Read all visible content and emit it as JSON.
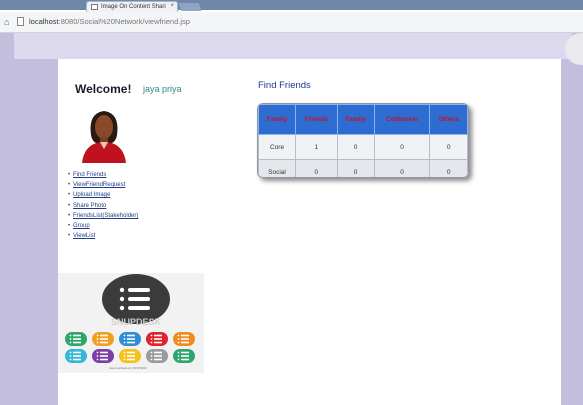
{
  "browser": {
    "tab_title": "Image On Content Shari",
    "tab_close": "×",
    "home_glyph": "⌂",
    "url_host": "localhost",
    "url_path": ":8080/Social%20Network/viewfriend.jsp"
  },
  "header": {
    "welcome": "Welcome!",
    "username": "jaya priya"
  },
  "sidebar": {
    "bullet": "•",
    "links": [
      {
        "label": "Find Friends"
      },
      {
        "label": "ViewFriendRequest"
      },
      {
        "label": "Upload Image"
      },
      {
        "label": "Share Photo"
      },
      {
        "label": "FriendsList(Stakeholder)"
      },
      {
        "label": "Group"
      },
      {
        "label": "ViewList"
      }
    ]
  },
  "logo": {
    "faded_text": "SNUPDESK",
    "small_text": "www.snupdesk.com     SNUPDESK",
    "dark_color": "#3b3b3b",
    "tile_colors": [
      "#2ea56b",
      "#f0a020",
      "#2d8ed6",
      "#e0232f",
      "#f08a1d",
      "#37b6d8",
      "#7a3fa5",
      "#f4c21c",
      "#9b9b9b",
      "#2ea56b"
    ]
  },
  "main": {
    "title": "Find Friends",
    "table": {
      "headers": [
        "Family",
        "Friends",
        "Family",
        "Collburker",
        "Others"
      ],
      "rows": [
        [
          "Core",
          "1",
          "0",
          "0",
          "0"
        ],
        [
          "Social",
          "0",
          "0",
          "0",
          "0"
        ]
      ]
    }
  },
  "colors": {
    "table_header_bg": "#2d6cd0",
    "table_header_text": "#c8102e",
    "page_frame": "#c4bede",
    "link": "#1f3d88"
  }
}
